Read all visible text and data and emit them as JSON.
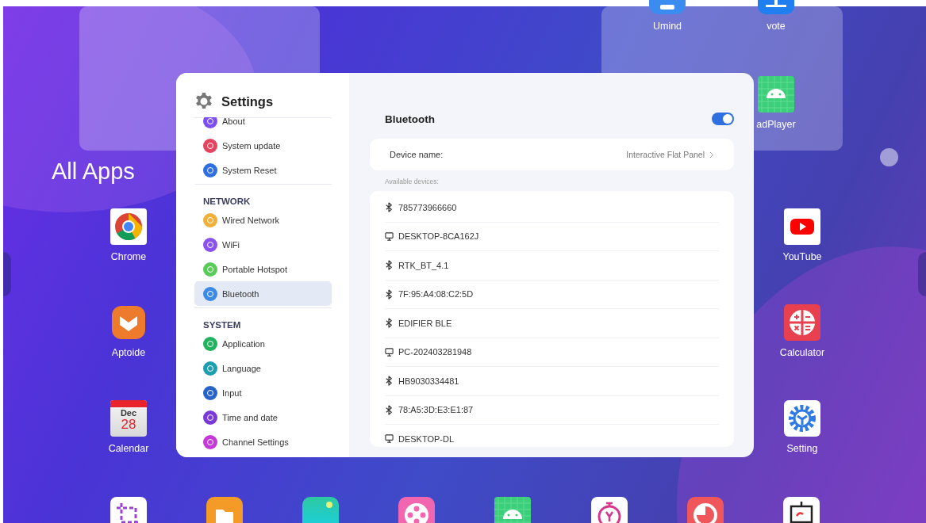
{
  "desktop": {
    "heading": "All Apps",
    "folder_apps": [
      {
        "label": "Umind",
        "kind": "umind"
      },
      {
        "label": "vote",
        "kind": "vote"
      },
      {
        "label": "adPlayer",
        "kind": "android"
      }
    ],
    "apps": [
      {
        "label": "Chrome",
        "kind": "chrome"
      },
      {
        "label": "Aptoide",
        "kind": "aptoide"
      },
      {
        "label": "Calendar",
        "kind": "calendar",
        "month": "Dec",
        "day": "28"
      },
      {
        "label": "YouTube",
        "kind": "youtube"
      },
      {
        "label": "Calculator",
        "kind": "calculator"
      },
      {
        "label": "Setting",
        "kind": "setting"
      }
    ],
    "dock": [
      {
        "kind": "crop"
      },
      {
        "kind": "folder"
      },
      {
        "kind": "gallery"
      },
      {
        "kind": "reel"
      },
      {
        "kind": "android"
      },
      {
        "kind": "timer"
      },
      {
        "kind": "clock"
      },
      {
        "kind": "easel"
      }
    ]
  },
  "settings": {
    "title": "Settings",
    "groups": [
      {
        "items": [
          {
            "label": "About",
            "color": "#7b4ff0",
            "selected": false
          },
          {
            "label": "System update",
            "color": "#e5445f",
            "selected": false
          },
          {
            "label": "System Reset",
            "color": "#2f6fe0",
            "selected": false
          }
        ]
      },
      {
        "heading": "NETWORK",
        "items": [
          {
            "label": "Wired Network",
            "color": "#f0b03a",
            "selected": false
          },
          {
            "label": "WiFi",
            "color": "#8a52ee",
            "selected": false
          },
          {
            "label": "Portable Hotspot",
            "color": "#5acb58",
            "selected": false
          },
          {
            "label": "Bluetooth",
            "color": "#3c8ae6",
            "selected": true
          }
        ]
      },
      {
        "heading": "SYSTEM",
        "items": [
          {
            "label": "Application",
            "color": "#22b25e",
            "selected": false
          },
          {
            "label": "Language",
            "color": "#1f9eb0",
            "selected": false
          },
          {
            "label": "Input",
            "color": "#2a63c8",
            "selected": false
          },
          {
            "label": "Time and date",
            "color": "#7a3ad6",
            "selected": false
          },
          {
            "label": "Channel Settings",
            "color": "#c43ad6",
            "selected": false
          }
        ]
      }
    ]
  },
  "bluetooth": {
    "title": "Bluetooth",
    "on": true,
    "device_name_label": "Device name:",
    "device_name_value": "Interactive Flat Panel",
    "available_label": "Available devices:",
    "devices": [
      {
        "name": "785773966660",
        "kind": "bluetooth"
      },
      {
        "name": "DESKTOP-8CA162J",
        "kind": "computer"
      },
      {
        "name": "RTK_BT_4.1",
        "kind": "bluetooth"
      },
      {
        "name": "7F:95:A4:08:C2:5D",
        "kind": "bluetooth"
      },
      {
        "name": "EDIFIER BLE",
        "kind": "bluetooth"
      },
      {
        "name": "PC-202403281948",
        "kind": "computer"
      },
      {
        "name": "HB9030334481",
        "kind": "bluetooth"
      },
      {
        "name": "78:A5:3D:E3:E1:87",
        "kind": "bluetooth"
      },
      {
        "name": "DESKTOP-DL",
        "kind": "computer"
      }
    ]
  }
}
